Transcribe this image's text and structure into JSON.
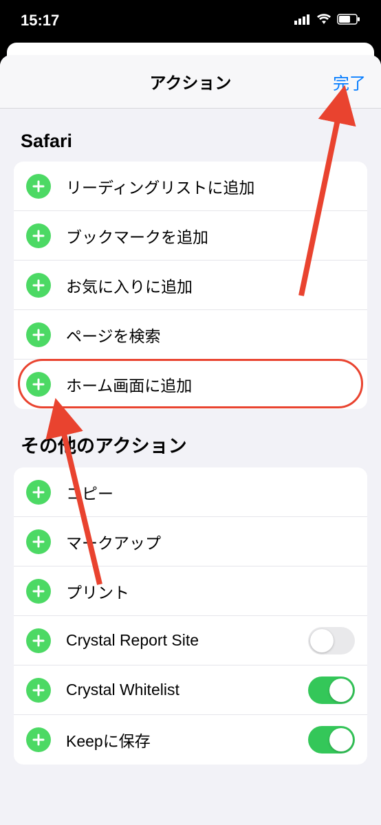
{
  "statusBar": {
    "time": "15:17"
  },
  "sheet": {
    "title": "アクション",
    "doneLabel": "完了"
  },
  "sections": {
    "safari": {
      "header": "Safari",
      "rows": [
        {
          "label": "リーディングリストに追加"
        },
        {
          "label": "ブックマークを追加"
        },
        {
          "label": "お気に入りに追加"
        },
        {
          "label": "ページを検索"
        },
        {
          "label": "ホーム画面に追加"
        }
      ]
    },
    "other": {
      "header": "その他のアクション",
      "rows": [
        {
          "label": "コピー"
        },
        {
          "label": "マークアップ"
        },
        {
          "label": "プリント"
        },
        {
          "label": "Crystal Report Site",
          "toggle": false
        },
        {
          "label": "Crystal Whitelist",
          "toggle": true
        },
        {
          "label": "Keepに保存",
          "toggle": true
        }
      ]
    }
  },
  "annotations": {
    "highlightRowIndex": 4,
    "arrows": [
      {
        "from": "highlight",
        "to": "done"
      },
      {
        "from": "below",
        "to": "highlight-icon"
      }
    ]
  },
  "colors": {
    "accent": "#007aff",
    "addGreen": "#4cd964",
    "toggleOn": "#34c759",
    "annotationRed": "#e9432f"
  }
}
